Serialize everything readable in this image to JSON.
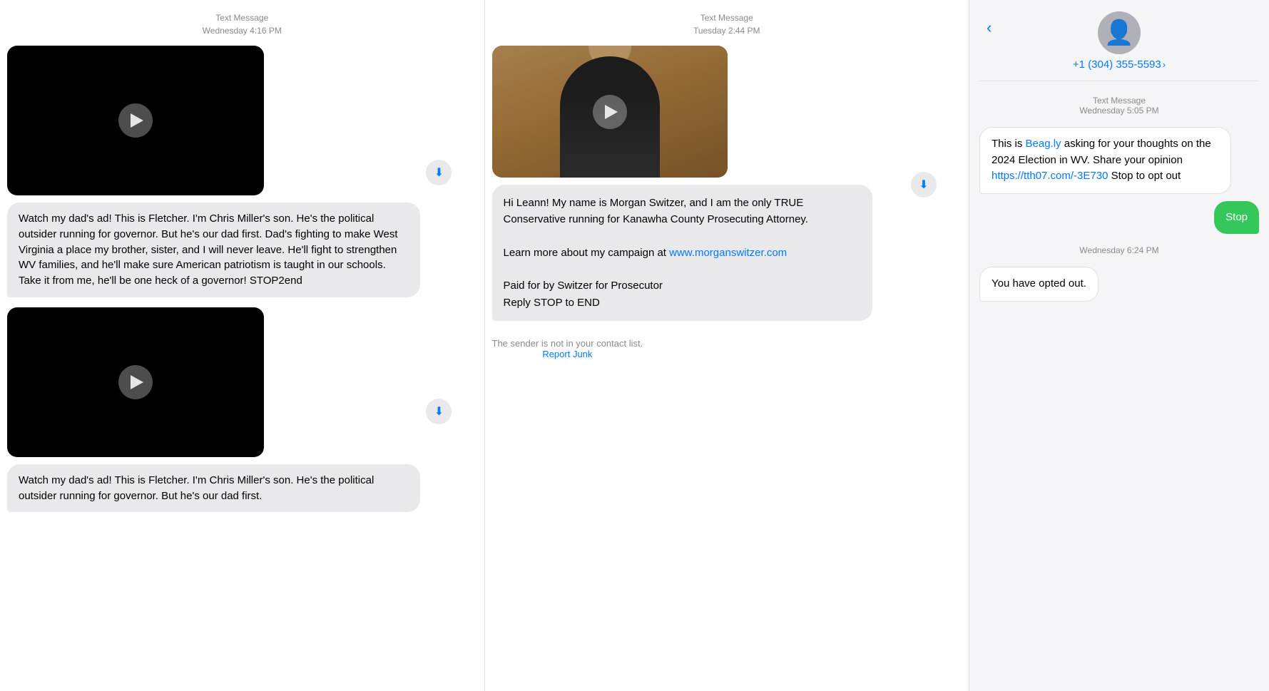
{
  "col1": {
    "timestamp_line1": "Text Message",
    "timestamp_line2": "Wednesday 4:16 PM",
    "message1_text": "Watch my dad's ad! This is Fletcher. I'm Chris Miller's son. He's the political outsider running for governor. But he's our dad first. Dad's fighting to make West Virginia a place my brother, sister, and I will never leave. He'll fight to strengthen WV families, and he'll make sure American patriotism is taught in our schools. Take it from me, he'll be one heck of a governor!\nSTOP2end",
    "timestamp2_line1": "",
    "timestamp2_line2": "",
    "message2_text": "Watch my dad's ad! This is Fletcher. I'm Chris Miller's son. He's the political outsider running for governor. But he's our dad first.",
    "download_label": "⬇"
  },
  "col2": {
    "timestamp_line1": "Text Message",
    "timestamp_line2": "Tuesday 2:44 PM",
    "message_text": "Hi Leann! My name is Morgan Switzer, and I am the only TRUE Conservative running for Kanawha County Prosecuting Attorney.\n\nLearn more about my campaign at www.morganswitzer.com\n\nPaid for by Switzer for Prosecutor\nReply STOP to END",
    "message_link": "www.morganswitzer.com",
    "report_note": "The sender is not in your contact list.",
    "report_link": "Report Junk",
    "download_label": "⬇"
  },
  "col3": {
    "back_icon": "‹",
    "contact_phone": "+1 (304) 355-5593",
    "chevron": "›",
    "timestamp_line1": "Text Message",
    "timestamp_line2": "Wednesday 5:05 PM",
    "message1_part1": "This is ",
    "message1_link": "Beag.ly",
    "message1_link_url": "https://beag.ly",
    "message1_part2": " asking for your thoughts on the 2024 Election in WV. Share your opinion ",
    "message1_link2": "https://tth07.com/-3E730",
    "message1_link2_url": "https://tth07.com/-3E730",
    "message1_part3": " Stop to opt out",
    "reply_text": "Stop",
    "timestamp2": "Wednesday 6:24 PM",
    "message2_text": "You have opted out."
  }
}
